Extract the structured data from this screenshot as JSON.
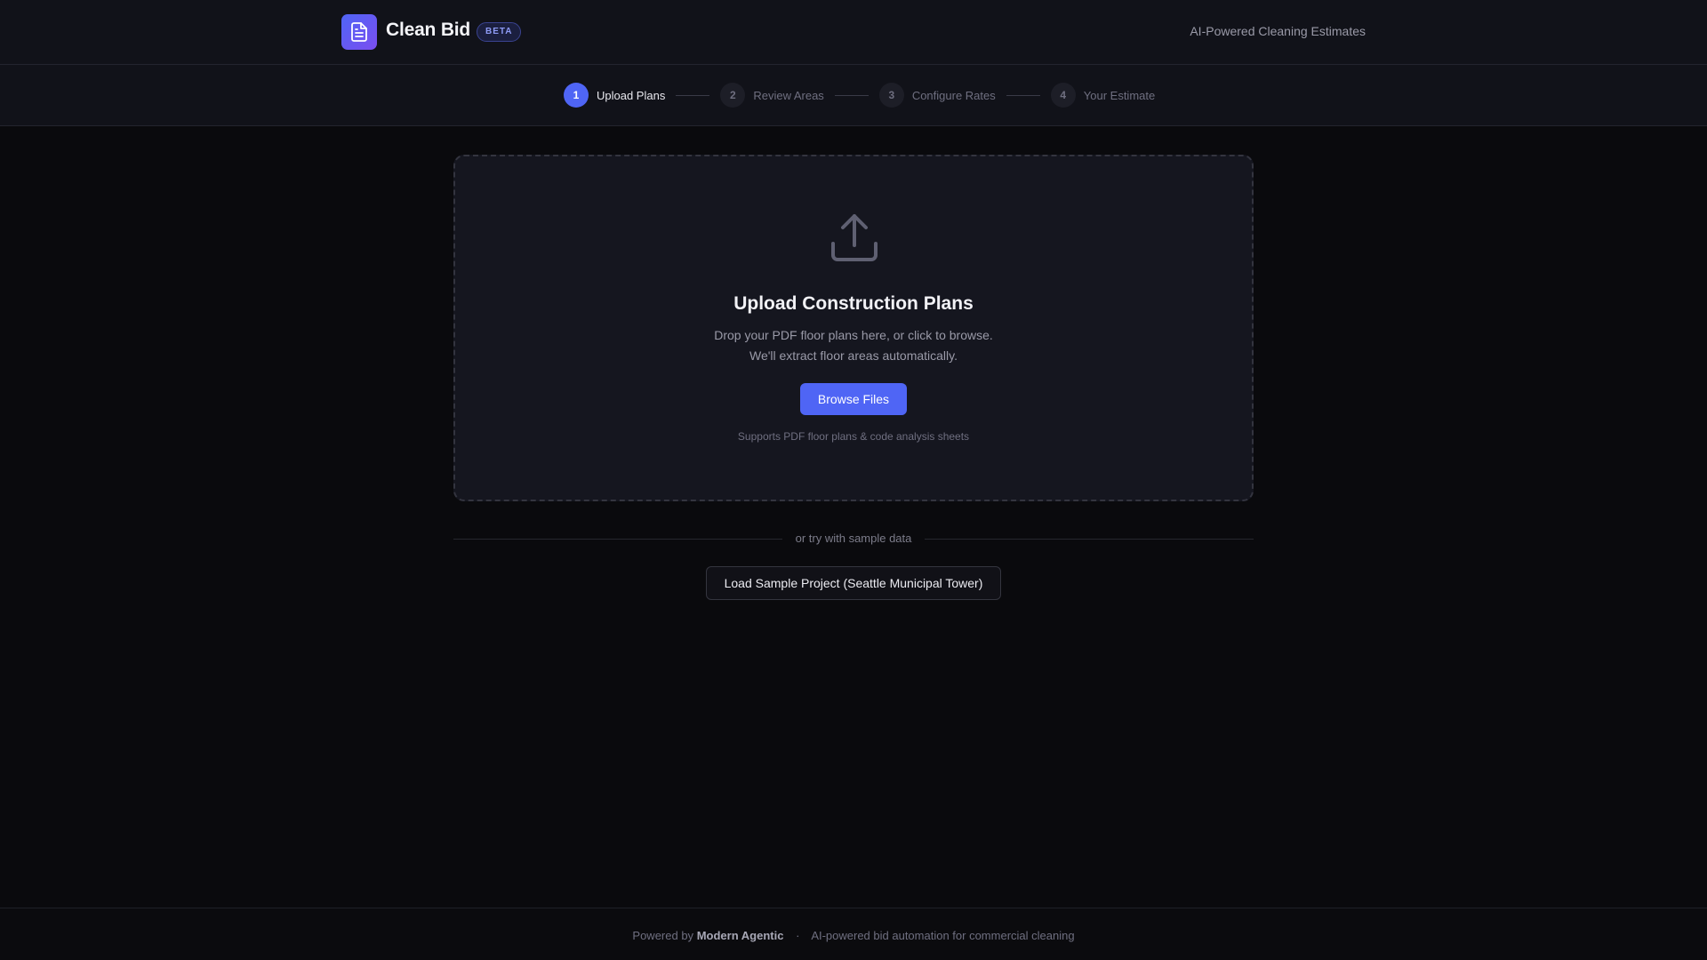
{
  "header": {
    "logo_icon": "document-icon",
    "app_name": "Clean Bid",
    "badge": "BETA",
    "tagline": "AI-Powered Cleaning Estimates"
  },
  "stepper": {
    "steps": [
      {
        "number": "1",
        "label": "Upload Plans",
        "active": true
      },
      {
        "number": "2",
        "label": "Review Areas",
        "active": false
      },
      {
        "number": "3",
        "label": "Configure Rates",
        "active": false
      },
      {
        "number": "4",
        "label": "Your Estimate",
        "active": false
      }
    ]
  },
  "dropzone": {
    "icon": "upload-icon",
    "title": "Upload Construction Plans",
    "description_line1": "Drop your PDF floor plans here, or click to browse.",
    "description_line2": "We'll extract floor areas automatically.",
    "browse_label": "Browse Files",
    "note": "Supports PDF floor plans & code analysis sheets"
  },
  "sample": {
    "divider_text": "or try with sample data",
    "button_label": "Load Sample Project (Seattle Municipal Tower)"
  },
  "footer": {
    "prefix": "Powered by",
    "brand": "Modern Agentic",
    "separator": "·",
    "description": "AI-powered bid automation for commercial cleaning"
  },
  "colors": {
    "accent": "#4f65f5",
    "background": "#0a0a0d",
    "panel": "#15161f"
  }
}
